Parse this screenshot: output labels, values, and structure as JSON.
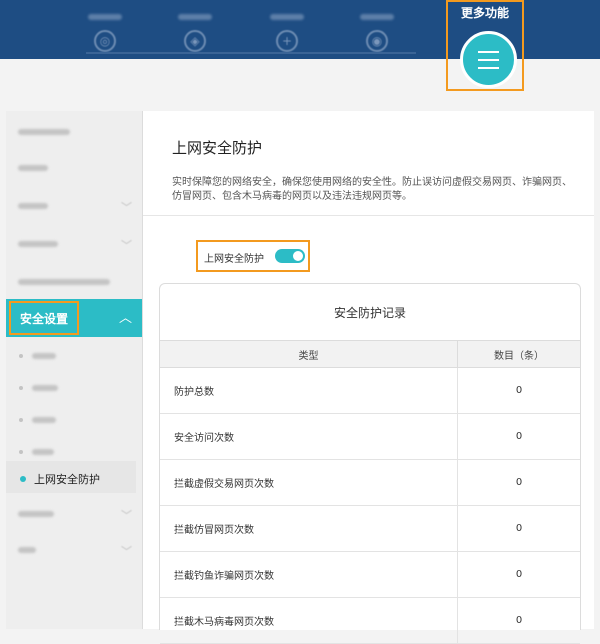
{
  "header": {
    "more_functions_label": "更多功能",
    "nav_icons": [
      "globe-icon",
      "devices-icon",
      "plus-icon",
      "user-icon"
    ]
  },
  "sidebar": {
    "active_item_label": "安全设置",
    "current_subitem_label": "上网安全防护"
  },
  "main": {
    "title": "上网安全防护",
    "description": "实时保障您的网络安全，确保您使用网络的安全性。防止误访问虚假交易网页、诈骗网页、仿冒网页、包含木马病毒的网页以及违法违规网页等。",
    "toggle_label": "上网安全防护",
    "toggle_on": true,
    "records": {
      "title": "安全防护记录",
      "columns": [
        "类型",
        "数目（条）"
      ],
      "rows": [
        {
          "type": "防护总数",
          "count": "0"
        },
        {
          "type": "安全访问次数",
          "count": "0"
        },
        {
          "type": "拦截虚假交易网页次数",
          "count": "0"
        },
        {
          "type": "拦截仿冒网页次数",
          "count": "0"
        },
        {
          "type": "拦截钓鱼诈骗网页次数",
          "count": "0"
        },
        {
          "type": "拦截木马病毒网页次数",
          "count": "0"
        }
      ]
    }
  },
  "colors": {
    "topbar": "#1e4d83",
    "accent": "#2cbcc6",
    "highlight_border": "#f39a1f"
  }
}
